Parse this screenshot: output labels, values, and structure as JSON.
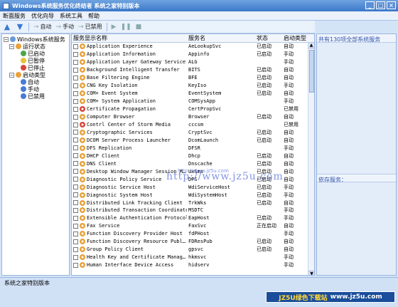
{
  "window": {
    "title": "Windows系统服务优化终结者  系统之家特别版本",
    "min_label": "_",
    "max_label": "□",
    "close_label": "×"
  },
  "menu": [
    "断面服务",
    "优化向导",
    "系统工具",
    "帮助"
  ],
  "toolbar": {
    "auto_label": "自动",
    "manual_label": "手动",
    "disabled_label": "已禁用"
  },
  "tree": {
    "root": "Windows系统服务",
    "groups": [
      {
        "label": "运行状态",
        "children": [
          "已启动",
          "已暂停",
          "已停止"
        ]
      },
      {
        "label": "启动类型",
        "children": [
          "自动",
          "手动",
          "已禁用"
        ]
      }
    ]
  },
  "list": {
    "headers": [
      "服务显示名称",
      "服务名",
      "状态",
      "启动类型"
    ],
    "rows": [
      {
        "display": "Application Experience",
        "name": "AeLookupSvc",
        "status": "已启动",
        "startup": "自动",
        "icon": "gear-icon"
      },
      {
        "display": "Application Information",
        "name": "Appinfo",
        "status": "已启动",
        "startup": "手动",
        "icon": "gear-icon"
      },
      {
        "display": "Application Layer Gateway Service",
        "name": "ALG",
        "status": "",
        "startup": "手动",
        "icon": "gear-icon"
      },
      {
        "display": "Background Intelligent Transfer",
        "name": "BITS",
        "status": "已启动",
        "startup": "自动",
        "icon": "gear-icon"
      },
      {
        "display": "Base Filtering Engine",
        "name": "BFE",
        "status": "已启动",
        "startup": "自动",
        "icon": "gear-icon"
      },
      {
        "display": "CNG Key Isolation",
        "name": "KeyIso",
        "status": "已启动",
        "startup": "手动",
        "icon": "gear-icon"
      },
      {
        "display": "COM+ Event System",
        "name": "EventSystem",
        "status": "已启动",
        "startup": "自动",
        "icon": "gear-icon"
      },
      {
        "display": "COM+ System Application",
        "name": "COMSysApp",
        "status": "",
        "startup": "手动",
        "icon": "gear-icon"
      },
      {
        "display": "Certificate Propagation",
        "name": "CertPropSvc",
        "status": "",
        "startup": "已禁用",
        "icon": "gear-red-icon"
      },
      {
        "display": "Computer Browser",
        "name": "Browser",
        "status": "已启动",
        "startup": "自动",
        "icon": "gear-icon"
      },
      {
        "display": "Contrl Center of Storm Media",
        "name": "cccsm",
        "status": "",
        "startup": "已禁用",
        "icon": "gear-red-icon"
      },
      {
        "display": "Cryptographic Services",
        "name": "CryptSvc",
        "status": "已启动",
        "startup": "自动",
        "icon": "gear-icon"
      },
      {
        "display": "DCOM Server Process Launcher",
        "name": "DcomLaunch",
        "status": "已启动",
        "startup": "自动",
        "icon": "gear-icon"
      },
      {
        "display": "DFS Replication",
        "name": "DFSR",
        "status": "",
        "startup": "手动",
        "icon": "gear-icon"
      },
      {
        "display": "DHCP Client",
        "name": "Dhcp",
        "status": "已启动",
        "startup": "自动",
        "icon": "gear-icon"
      },
      {
        "display": "DNS Client",
        "name": "Dnscache",
        "status": "已启动",
        "startup": "自动",
        "icon": "gear-icon"
      },
      {
        "display": "Desktop Window Manager Session M…",
        "name": "UxSms",
        "status": "已启动",
        "startup": "自动",
        "icon": "gear-icon"
      },
      {
        "display": "Diagnostic Policy Service",
        "name": "DPS",
        "status": "已启动",
        "startup": "自动",
        "icon": "gear-icon"
      },
      {
        "display": "Diagnostic Service Host",
        "name": "WdiServiceHost",
        "status": "已启动",
        "startup": "手动",
        "icon": "gear-icon"
      },
      {
        "display": "Diagnostic System Host",
        "name": "WdiSystemHost",
        "status": "已启动",
        "startup": "手动",
        "icon": "gear-icon"
      },
      {
        "display": "Distributed Link Tracking Client",
        "name": "TrkWks",
        "status": "已启动",
        "startup": "自动",
        "icon": "gear-icon"
      },
      {
        "display": "Distributed Transaction Coordinator",
        "name": "MSDTC",
        "status": "",
        "startup": "手动",
        "icon": "gear-icon"
      },
      {
        "display": "Extensible Authentication Protocol",
        "name": "EapHost",
        "status": "已启动",
        "startup": "手动",
        "icon": "gear-icon"
      },
      {
        "display": "Fax Service",
        "name": "FaxSvc",
        "status": "正在启动",
        "startup": "自动",
        "icon": "gear-icon"
      },
      {
        "display": "Function Discovery Provider Host",
        "name": "fdPHost",
        "status": "",
        "startup": "手动",
        "icon": "gear-icon"
      },
      {
        "display": "Function Discovery Resource Publ…",
        "name": "FDResPub",
        "status": "已启动",
        "startup": "自动",
        "icon": "gear-icon"
      },
      {
        "display": "Group Policy Client",
        "name": "gpsvc",
        "status": "已启动",
        "startup": "自动",
        "icon": "gear-icon"
      },
      {
        "display": "Health Key and Certificate Manag…",
        "name": "hkmsvc",
        "status": "",
        "startup": "手动",
        "icon": "gear-icon"
      },
      {
        "display": "Human Interface Device Access",
        "name": "hidserv",
        "status": "",
        "startup": "手动",
        "icon": "gear-icon"
      }
    ]
  },
  "right_panel": {
    "summary": "共有130项全部系统服务",
    "depends": "依存服务："
  },
  "status": {
    "text": "系统之家特别版本"
  },
  "watermark": {
    "small": "http://www.jz5u.com",
    "large": "http://www.jz5u.com"
  },
  "brand": {
    "left": "JZ5U绿色下载站",
    "right": "www.jz5u.com"
  }
}
